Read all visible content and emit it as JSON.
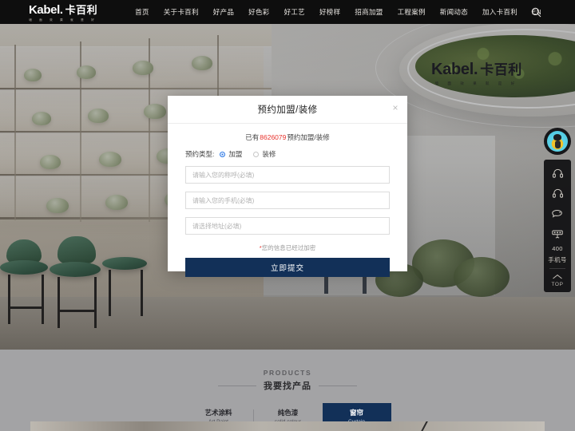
{
  "site": {
    "logo_en": "Kabel.",
    "logo_cn": "卡百利",
    "logo_sub": "墙 面 效 果 就 是 好",
    "hero_logo_en": "Kabel.",
    "hero_logo_cn": "卡百利",
    "hero_logo_sub": "墙 面 效 果 就 是 好"
  },
  "nav": {
    "items": [
      {
        "label": "首页"
      },
      {
        "label": "关于卡百利"
      },
      {
        "label": "好产品"
      },
      {
        "label": "好色彩"
      },
      {
        "label": "好工艺"
      },
      {
        "label": "好榜样"
      },
      {
        "label": "招商加盟"
      },
      {
        "label": "工程案例"
      },
      {
        "label": "新闻动态"
      },
      {
        "label": "加入卡百利"
      },
      {
        "label": "EN"
      }
    ],
    "search_icon": "search-icon"
  },
  "modal": {
    "title": "预约加盟/装修",
    "close_label": "×",
    "counter_prefix": "已有",
    "counter_number": "8626079",
    "counter_suffix": "预约加盟/装修",
    "type_label": "预约类型:",
    "options": [
      {
        "label": "加盟",
        "selected": true
      },
      {
        "label": "装修",
        "selected": false
      }
    ],
    "fields": [
      {
        "placeholder": "请输入您的称呼(必填)",
        "value": ""
      },
      {
        "placeholder": "请输入您的手机(必填)",
        "value": ""
      },
      {
        "placeholder": "请选择地址(必填)",
        "value": ""
      }
    ],
    "note_star": "*",
    "note": "您的信息已经过加密",
    "submit_label": "立即提交",
    "accent_color": "#123058",
    "highlight_color": "#e8322c",
    "radio_color": "#2f7ae5"
  },
  "float_toolbar": {
    "avatar": "mascot-avatar",
    "items": [
      {
        "icon": "headset-icon",
        "label": ""
      },
      {
        "icon": "headset-icon",
        "label": ""
      },
      {
        "icon": "chat-bubble-icon",
        "label": ""
      },
      {
        "icon": "phone-icon",
        "label": ""
      }
    ],
    "phone_label": "400",
    "mobile_label": "手机号",
    "top_label": "TOP",
    "top_icon": "chevron-up-icon"
  },
  "products": {
    "title_en": "PRODUCTS",
    "title_cn": "我要找产品",
    "tabs": [
      {
        "cn": "艺术涂料",
        "en": "Art Paint",
        "active": false
      },
      {
        "cn": "纯色漆",
        "en": "solid colour",
        "active": false
      },
      {
        "cn": "窗帘",
        "en": "Curtain",
        "active": true
      }
    ]
  }
}
